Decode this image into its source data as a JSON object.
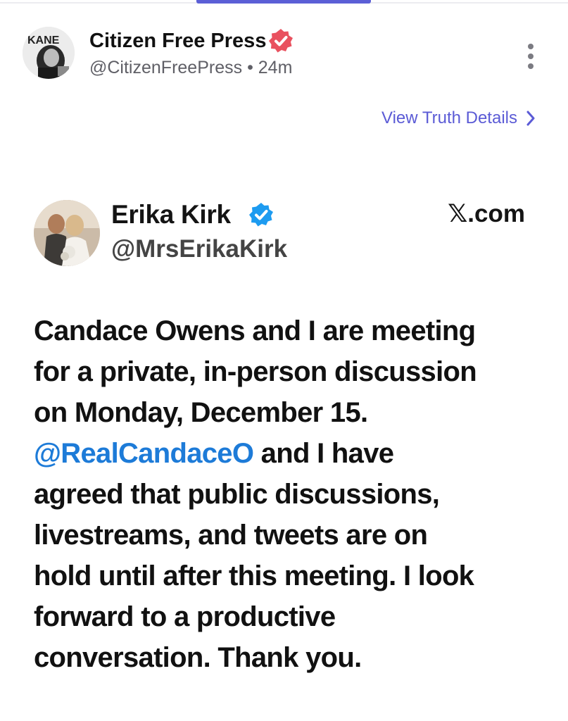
{
  "post": {
    "author_name": "Citizen Free Press",
    "author_handle": "@CitizenFreePress",
    "separator": "•",
    "time_ago": "24m",
    "avatar_text": "KANE",
    "details_link": "View Truth Details"
  },
  "embed": {
    "name": "Erika Kirk",
    "handle": "@MrsErikaKirk",
    "source": "𝕏.com",
    "text": {
      "line1": "Candace Owens and I are meeting",
      "line2": "for a private, in-person discussion",
      "line3": "on Monday, December 15.",
      "mention": "@RealCandaceO",
      "line4_rest": " and I have",
      "line5": "agreed that public discussions,",
      "line6": "livestreams, and tweets are on",
      "line7": "hold until after this meeting. I look",
      "line8": "forward to a productive",
      "line9": "conversation. Thank you."
    }
  },
  "colors": {
    "accent": "#5b5fd6",
    "verified_badge_pink": "#e9515f",
    "verified_blue": "#1d9bf0",
    "mention": "#1d7bd8"
  },
  "icons": [
    "kane-avatar-icon",
    "verified-badge-icon",
    "more-vertical-icon",
    "chevron-right-icon",
    "verified-check-icon",
    "couple-photo-avatar-icon"
  ]
}
